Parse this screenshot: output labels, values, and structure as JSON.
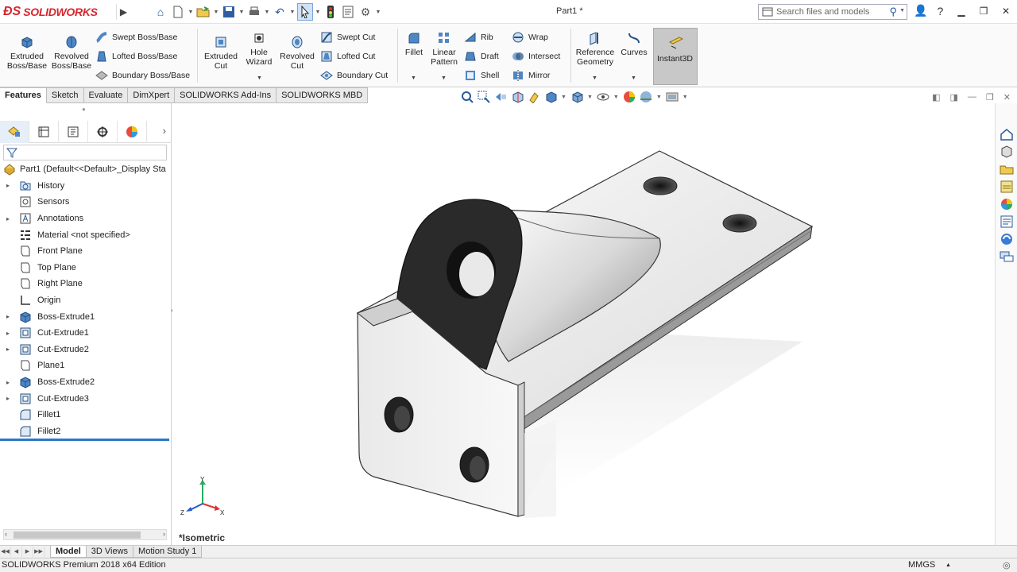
{
  "app": {
    "brand": "SOLIDWORKS",
    "doc_title": "Part1 *"
  },
  "search": {
    "placeholder": "Search files and models"
  },
  "ribbon": {
    "extruded_boss": "Extruded Boss/Base",
    "revolved_boss": "Revolved Boss/Base",
    "swept_boss": "Swept Boss/Base",
    "lofted_boss": "Lofted Boss/Base",
    "boundary_boss": "Boundary Boss/Base",
    "extruded_cut": "Extruded Cut",
    "hole_wizard": "Hole Wizard",
    "revolved_cut": "Revolved Cut",
    "swept_cut": "Swept Cut",
    "lofted_cut": "Lofted Cut",
    "boundary_cut": "Boundary Cut",
    "fillet": "Fillet",
    "linear_pattern": "Linear Pattern",
    "rib": "Rib",
    "draft": "Draft",
    "shell": "Shell",
    "wrap": "Wrap",
    "intersect": "Intersect",
    "mirror": "Mirror",
    "reference_geometry": "Reference Geometry",
    "curves": "Curves",
    "instant3d": "Instant3D"
  },
  "command_tabs": [
    "Features",
    "Sketch",
    "Evaluate",
    "DimXpert",
    "SOLIDWORKS Add-Ins",
    "SOLIDWORKS MBD"
  ],
  "tree": {
    "root": "Part1  (Default<<Default>_Display Sta",
    "items": [
      {
        "label": "History",
        "expandable": true,
        "icon": "history-folder-icon"
      },
      {
        "label": "Sensors",
        "expandable": false,
        "icon": "sensors-icon"
      },
      {
        "label": "Annotations",
        "expandable": true,
        "icon": "annotations-icon"
      },
      {
        "label": "Material <not specified>",
        "expandable": false,
        "icon": "material-icon"
      },
      {
        "label": "Front Plane",
        "expandable": false,
        "icon": "plane-icon"
      },
      {
        "label": "Top Plane",
        "expandable": false,
        "icon": "plane-icon"
      },
      {
        "label": "Right Plane",
        "expandable": false,
        "icon": "plane-icon"
      },
      {
        "label": "Origin",
        "expandable": false,
        "icon": "origin-icon"
      },
      {
        "label": "Boss-Extrude1",
        "expandable": true,
        "icon": "boss-extrude-icon"
      },
      {
        "label": "Cut-Extrude1",
        "expandable": true,
        "icon": "cut-extrude-icon"
      },
      {
        "label": "Cut-Extrude2",
        "expandable": true,
        "icon": "cut-extrude-icon"
      },
      {
        "label": "Plane1",
        "expandable": false,
        "icon": "plane-icon"
      },
      {
        "label": "Boss-Extrude2",
        "expandable": true,
        "icon": "boss-extrude-icon"
      },
      {
        "label": "Cut-Extrude3",
        "expandable": true,
        "icon": "cut-extrude-icon"
      },
      {
        "label": "Fillet1",
        "expandable": false,
        "icon": "fillet-icon"
      },
      {
        "label": "Fillet2",
        "expandable": false,
        "icon": "fillet-icon"
      }
    ]
  },
  "viewport": {
    "view_label": "*Isometric",
    "triad": {
      "x": "X",
      "y": "Y",
      "z": "Z"
    }
  },
  "bottom_tabs": [
    "Model",
    "3D Views",
    "Motion Study 1"
  ],
  "status": {
    "text": "SOLIDWORKS Premium 2018 x64 Edition",
    "units": "MMGS"
  },
  "colors": {
    "brand": "#d6262e",
    "accent": "#2b78c5",
    "instant3d_bg": "#c8c8c8"
  }
}
